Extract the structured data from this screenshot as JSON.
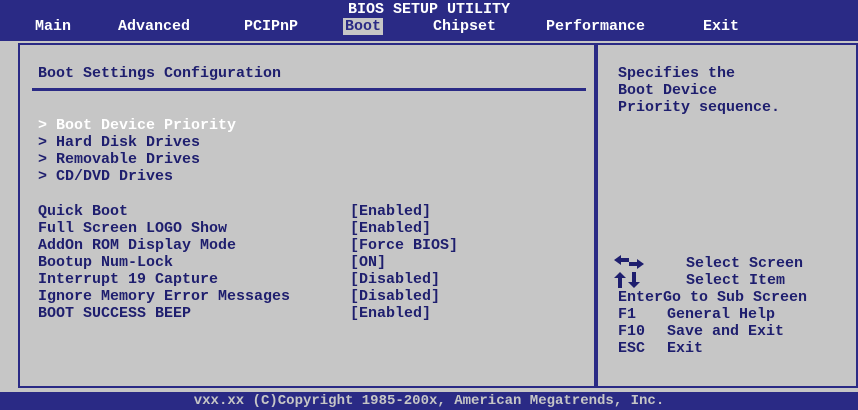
{
  "header": {
    "title": "BIOS SETUP UTILITY",
    "tabs": [
      {
        "label": "Main"
      },
      {
        "label": "Advanced"
      },
      {
        "label": "PCIPnP"
      },
      {
        "label": "Boot"
      },
      {
        "label": "Chipset"
      },
      {
        "label": "Performance"
      },
      {
        "label": "Exit"
      }
    ],
    "active_tab": "Boot"
  },
  "main": {
    "section_title": "Boot Settings Configuration",
    "submenus": [
      {
        "label": "> Boot Device Priority"
      },
      {
        "label": "> Hard Disk Drives"
      },
      {
        "label": "> Removable Drives"
      },
      {
        "label": "> CD/DVD Drives"
      }
    ],
    "options": [
      {
        "label": "Quick Boot",
        "value": "[Enabled]"
      },
      {
        "label": "Full Screen LOGO Show",
        "value": "[Enabled]"
      },
      {
        "label": "AddOn ROM Display Mode",
        "value": "[Force BIOS]"
      },
      {
        "label": "Bootup Num-Lock",
        "value": "[ON]"
      },
      {
        "label": "Interrupt 19 Capture",
        "value": "[Disabled]"
      },
      {
        "label": "Ignore Memory Error Messages",
        "value": "[Disabled]"
      },
      {
        "label": "BOOT SUCCESS BEEP",
        "value": "[Enabled]"
      }
    ]
  },
  "help": {
    "text": "Specifies the\nBoot Device\nPriority sequence."
  },
  "hints": [
    {
      "key": "",
      "icon": "left-right-arrows-icon",
      "desc": "Select Screen"
    },
    {
      "key": "",
      "icon": "up-down-arrows-icon",
      "desc": "Select Item"
    },
    {
      "key": "Enter",
      "desc": "Go to Sub Screen"
    },
    {
      "key": "F1",
      "desc": "General Help"
    },
    {
      "key": "F10",
      "desc": "Save and Exit"
    },
    {
      "key": "ESC",
      "desc": "Exit"
    }
  ],
  "footer": {
    "text": "vxx.xx (C)Copyright 1985-200x, American Megatrends, Inc."
  },
  "colors": {
    "background": "#c6c6c6",
    "accent": "#2a2a85",
    "text": "#1e1e6e",
    "highlight_text": "#ffffff"
  }
}
